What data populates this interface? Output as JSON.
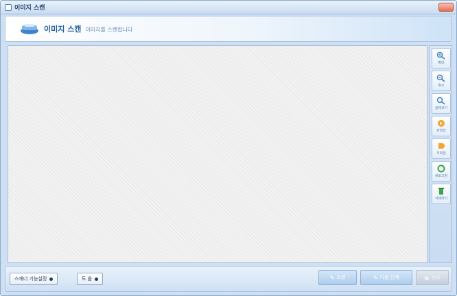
{
  "window": {
    "title": "이미지 스캔"
  },
  "banner": {
    "title": "이미지 스캔",
    "subtitle": "이미지를 스캔합니다"
  },
  "toolbar": {
    "zoom_in": "확대",
    "zoom_out": "축소",
    "fit": "실제크기",
    "rotate_left": "좌회전",
    "rotate_right": "우회전",
    "refresh": "새로고침",
    "delete": "삭제하기"
  },
  "footer": {
    "scanner_settings": "스캐너 기능설정",
    "help": "도 움",
    "scan": "스캔",
    "next": "다음 단계",
    "finish": "완료"
  },
  "colors": {
    "accent": "#1f5c9e",
    "panel": "#cfe0f3"
  }
}
